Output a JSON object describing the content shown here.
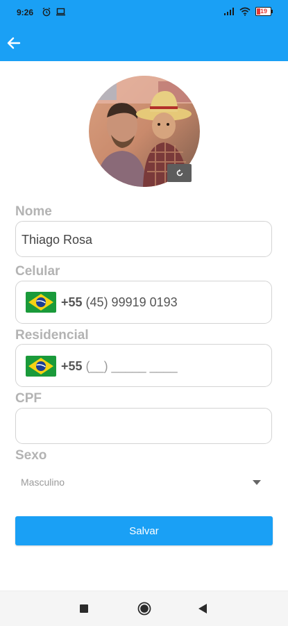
{
  "status_bar": {
    "time": "9:26",
    "battery": "19"
  },
  "app_bar": {
    "back_icon": "arrow-left-icon",
    "color": "#1aa0f5"
  },
  "profile": {
    "rotate_icon": "rotate-icon"
  },
  "form": {
    "name": {
      "label": "Nome",
      "value": "Thiago Rosa"
    },
    "mobile": {
      "label": "Celular",
      "country_code": "+55",
      "number": "(45) 99919 0193"
    },
    "home": {
      "label": "Residencial",
      "country_code": "+55",
      "placeholder": "(__) _____ ____"
    },
    "cpf": {
      "label": "CPF",
      "value": ""
    },
    "gender": {
      "label": "Sexo",
      "selected": "Masculino"
    }
  },
  "actions": {
    "save_label": "Salvar"
  },
  "nav_bar": {
    "recents_icon": "square-icon",
    "home_icon": "circle-icon",
    "back_icon": "triangle-back-icon"
  }
}
